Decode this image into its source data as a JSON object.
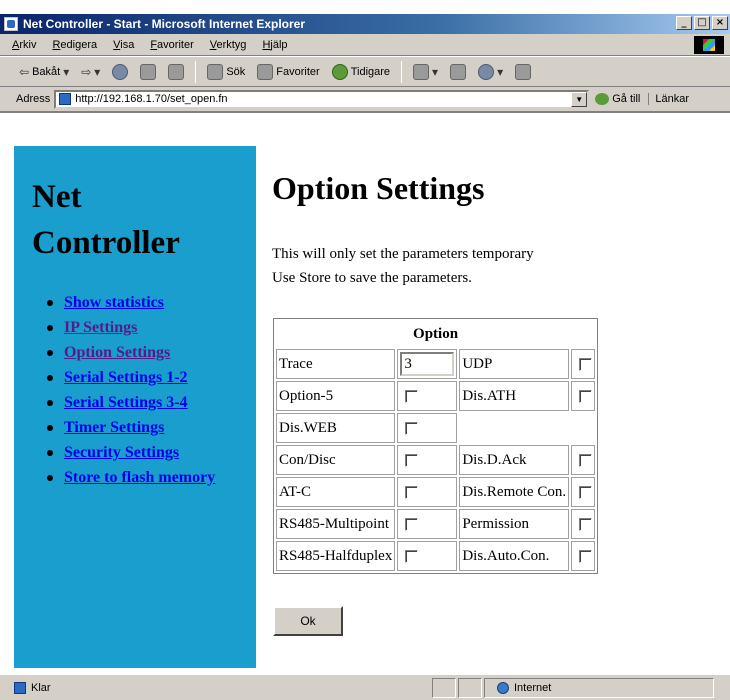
{
  "window": {
    "title": "Net Controller - Start - Microsoft Internet Explorer",
    "buttons": [
      "_",
      "□",
      "×"
    ]
  },
  "menu": [
    "Arkiv",
    "Redigera",
    "Visa",
    "Favoriter",
    "Verktyg",
    "Hjälp"
  ],
  "toolbar": {
    "back": "Bakåt",
    "search": "Sök",
    "favorites": "Favoriter",
    "history": "Tidigare"
  },
  "address": {
    "label": "Adress",
    "url": "http://192.168.1.70/set_open.fn",
    "go": "Gå till",
    "links": "Länkar"
  },
  "sidebar": {
    "title_line1": "Net",
    "title_line2": "Controller",
    "items": [
      {
        "label": "Show statistics"
      },
      {
        "label": "IP Settings"
      },
      {
        "label": "Option Settings"
      },
      {
        "label": "Serial Settings 1-2"
      },
      {
        "label": "Serial Settings 3-4"
      },
      {
        "label": "Timer Settings"
      },
      {
        "label": "Security Settings"
      },
      {
        "label": "Store to flash memory"
      }
    ]
  },
  "content": {
    "heading": "Option Settings",
    "note1": "This will only set the parameters temporary",
    "note2": "Use Store to save the parameters.",
    "table_header": "Option",
    "rows": [
      {
        "left": "Trace",
        "left_value": "3",
        "right": "UDP"
      },
      {
        "left": "Option-5",
        "right": "Dis.ATH"
      },
      {
        "left": "Dis.WEB"
      },
      {
        "left": "Con/Disc",
        "right": "Dis.D.Ack"
      },
      {
        "left": "AT-C",
        "right": "Dis.Remote Con."
      },
      {
        "left": "RS485-Multipoint",
        "right": "Permission"
      },
      {
        "left": "RS485-Halfduplex",
        "right": "Dis.Auto.Con."
      }
    ],
    "ok_label": "Ok"
  },
  "status": {
    "text": "Klar",
    "zone": "Internet"
  }
}
